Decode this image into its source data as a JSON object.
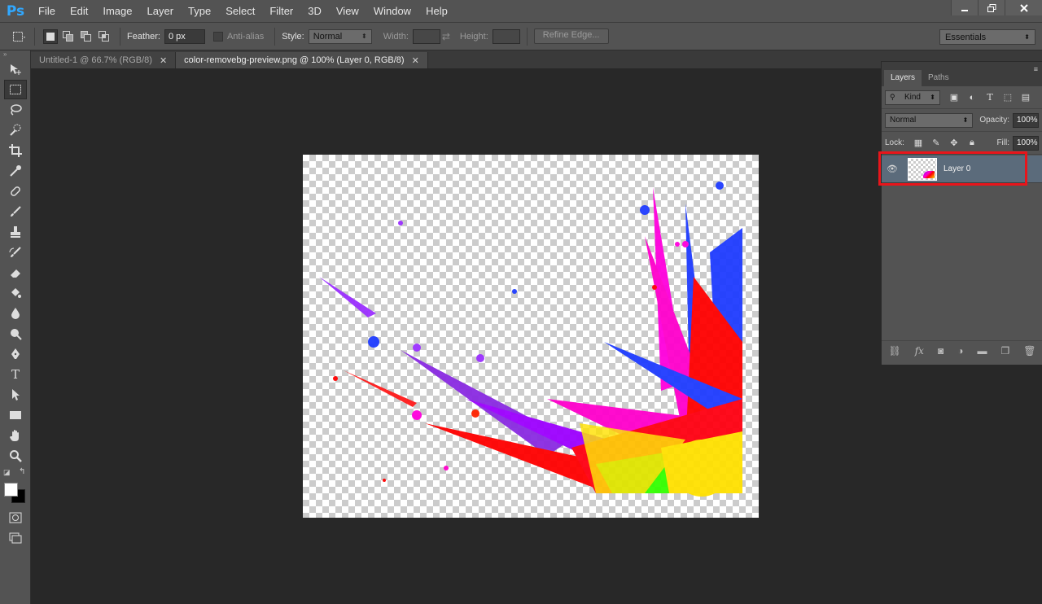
{
  "app": {
    "logo": "Ps"
  },
  "menu": [
    "File",
    "Edit",
    "Image",
    "Layer",
    "Type",
    "Select",
    "Filter",
    "3D",
    "View",
    "Window",
    "Help"
  ],
  "options": {
    "feather_label": "Feather:",
    "feather_value": "0 px",
    "antialias_label": "Anti-alias",
    "style_label": "Style:",
    "style_value": "Normal",
    "width_label": "Width:",
    "height_label": "Height:",
    "refine_edge": "Refine Edge...",
    "workspace": "Essentials"
  },
  "tabs": [
    {
      "label": "Untitled-1 @ 66.7% (RGB/8)",
      "active": false
    },
    {
      "label": "color-removebg-preview.png @ 100% (Layer 0, RGB/8)",
      "active": true
    }
  ],
  "tools": [
    "move-tool",
    "marquee-tool",
    "lasso-tool",
    "quick-select-tool",
    "crop-tool",
    "eyedropper-tool",
    "healing-tool",
    "brush-tool",
    "stamp-tool",
    "history-brush-tool",
    "eraser-tool",
    "paint-bucket-tool",
    "blur-tool",
    "dodge-tool",
    "pen-tool",
    "type-tool",
    "path-select-tool",
    "rectangle-tool",
    "hand-tool",
    "zoom-tool"
  ],
  "layers_panel": {
    "tabs": [
      "Layers",
      "Paths"
    ],
    "filter_kind": "Kind",
    "blend_mode": "Normal",
    "opacity_label": "Opacity:",
    "opacity_value": "100%",
    "lock_label": "Lock:",
    "fill_label": "Fill:",
    "fill_value": "100%",
    "layers": [
      {
        "name": "Layer 0",
        "visible": true,
        "selected": true
      }
    ]
  },
  "colors": {
    "accent_logo": "#31a8ff",
    "highlight_box": "#e8151b",
    "foreground": "#ffffff",
    "background": "#000000"
  }
}
